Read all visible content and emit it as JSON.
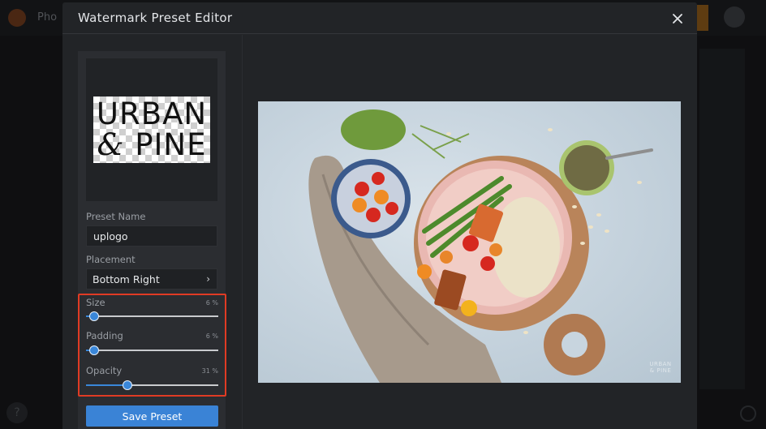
{
  "background": {
    "app_title": "Pho"
  },
  "modal": {
    "title": "Watermark Preset Editor",
    "close_icon": "close-icon"
  },
  "logo": {
    "line1": "URBAN",
    "line2_amp": "&",
    "line2_word": "PINE"
  },
  "preset_name": {
    "label": "Preset Name",
    "value": "uplogo"
  },
  "placement": {
    "label": "Placement",
    "value": "Bottom Right",
    "chevron": "›"
  },
  "sliders": {
    "size": {
      "label": "Size",
      "value_text": "6 %",
      "value": 6
    },
    "padding": {
      "label": "Padding",
      "value_text": "6 %",
      "value": 6
    },
    "opacity": {
      "label": "Opacity",
      "value_text": "31 %",
      "value": 31
    }
  },
  "save_button": {
    "label": "Save Preset"
  },
  "preview": {
    "watermark_line1": "URBAN",
    "watermark_line2": "& PINE"
  },
  "colors": {
    "accent": "#3a83d6",
    "highlight_border": "#e03b24",
    "modal_bg": "#222427",
    "panel_bg": "#2b2d31"
  }
}
